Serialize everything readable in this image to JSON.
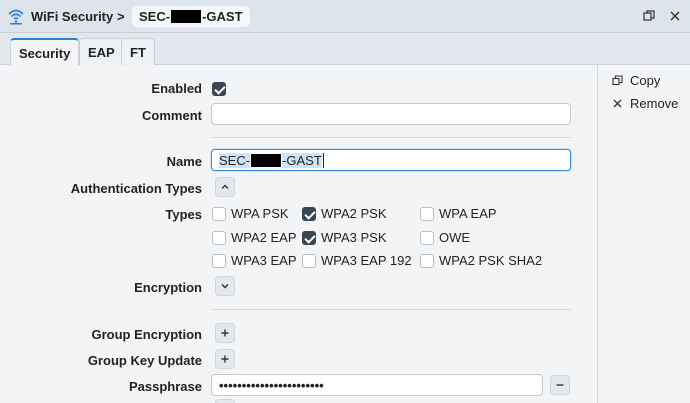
{
  "titlebar": {
    "title": "WiFi Security",
    "separator": ">",
    "chip_prefix": "SEC-",
    "chip_suffix": "-GAST",
    "icons": [
      "wifi-icon",
      "restore-icon",
      "close-icon"
    ]
  },
  "tabs": [
    {
      "label": "Security",
      "active": true
    },
    {
      "label": "EAP",
      "active": false
    },
    {
      "label": "FT",
      "active": false
    }
  ],
  "sidebar": {
    "copy_label": "Copy",
    "remove_label": "Remove"
  },
  "form": {
    "enabled_label": "Enabled",
    "enabled_checked": true,
    "comment_label": "Comment",
    "comment_value": "",
    "name_label": "Name",
    "name_prefix": "SEC-",
    "name_suffix": "-GAST",
    "auth_types_label": "Authentication Types",
    "types_label": "Types",
    "types": [
      {
        "label": "WPA PSK",
        "checked": false
      },
      {
        "label": "WPA2 PSK",
        "checked": true
      },
      {
        "label": "WPA EAP",
        "checked": false
      },
      {
        "label": "WPA2 EAP",
        "checked": false
      },
      {
        "label": "WPA3 PSK",
        "checked": true
      },
      {
        "label": "OWE",
        "checked": false
      },
      {
        "label": "WPA3 EAP",
        "checked": false
      },
      {
        "label": "WPA3 EAP 192",
        "checked": false
      },
      {
        "label": "WPA2 PSK SHA2",
        "checked": false
      }
    ],
    "encryption_label": "Encryption",
    "group_encryption_label": "Group Encryption",
    "group_key_update_label": "Group Key Update",
    "passphrase_label": "Passphrase",
    "passphrase_value": "•••••••••••••••••••••••"
  },
  "colors": {
    "accent": "#2b7fd1",
    "checkbox_on": "#3b4654",
    "titlebar_bg": "#dde4ec"
  }
}
